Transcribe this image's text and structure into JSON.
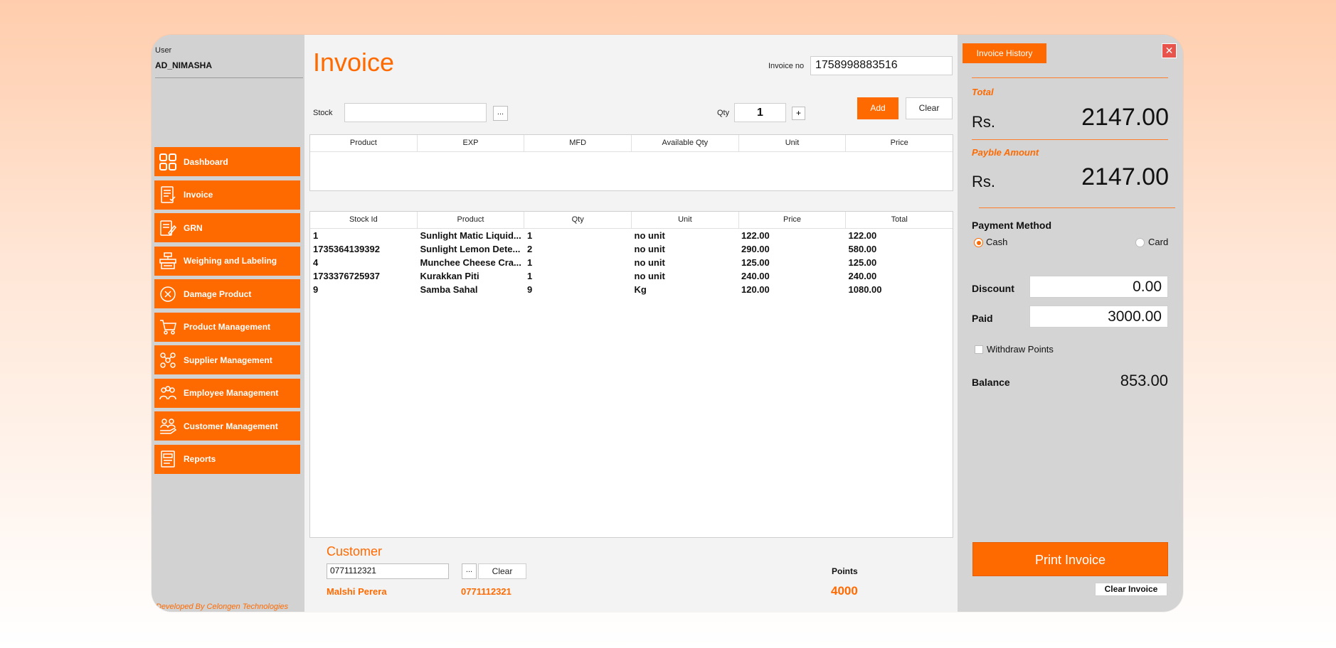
{
  "sidebar": {
    "user_label": "User",
    "user_name": "AD_NIMASHA",
    "items": [
      {
        "label": "Dashboard",
        "icon": "dashboard-icon"
      },
      {
        "label": "Invoice",
        "icon": "invoice-icon"
      },
      {
        "label": "GRN",
        "icon": "grn-icon"
      },
      {
        "label": "Weighing and Labeling",
        "icon": "scale-icon"
      },
      {
        "label": "Damage Product",
        "icon": "damage-icon"
      },
      {
        "label": "Product Management",
        "icon": "cart-icon"
      },
      {
        "label": "Supplier Management",
        "icon": "supplier-icon"
      },
      {
        "label": "Employee Management",
        "icon": "employee-icon"
      },
      {
        "label": "Customer Management",
        "icon": "customer-icon"
      },
      {
        "label": "Reports",
        "icon": "report-icon"
      }
    ],
    "credit": "Developed By Celongen Technologies"
  },
  "main": {
    "title": "Invoice",
    "invoice_no_label": "Invoice no",
    "invoice_no": "1758998883516",
    "stock_label": "Stock",
    "stock_value": "",
    "dots_label": "...",
    "qty_label": "Qty",
    "qty_value": "1",
    "plus_label": "+",
    "add_label": "Add",
    "clear_label": "Clear",
    "stock_table": {
      "columns": [
        "Product",
        "EXP",
        "MFD",
        "Available Qty",
        "Unit",
        "Price"
      ],
      "rows": []
    },
    "invoice_table": {
      "columns": [
        "Stock Id",
        "Product",
        "Qty",
        "Unit",
        "Price",
        "Total"
      ],
      "rows": [
        [
          "1",
          "Sunlight Matic Liquid...",
          "1",
          "no unit",
          "122.00",
          "122.00"
        ],
        [
          "1735364139392",
          "Sunlight Lemon Dete...",
          "2",
          "no unit",
          "290.00",
          "580.00"
        ],
        [
          "4",
          "Munchee Cheese Cra...",
          "1",
          "no unit",
          "125.00",
          "125.00"
        ],
        [
          "1733376725937",
          "Kurakkan Piti",
          "1",
          "no unit",
          "240.00",
          "240.00"
        ],
        [
          "9",
          "Samba Sahal",
          "9",
          "Kg",
          "120.00",
          "1080.00"
        ]
      ]
    },
    "customer": {
      "title": "Customer",
      "phone_input": "0771112321",
      "dots_label": "...",
      "clear_label": "Clear",
      "name": "Malshi Perera",
      "phone": "0771112321",
      "points_label": "Points",
      "points": "4000"
    }
  },
  "right": {
    "history_label": "Invoice History",
    "close_label": "✕",
    "total_label": "Total",
    "currency": "Rs.",
    "total": "2147.00",
    "payable_label": "Payble Amount",
    "payable": "2147.00",
    "payment_method_label": "Payment Method",
    "cash_label": "Cash",
    "card_label": "Card",
    "selected_method": "Cash",
    "discount_label": "Discount",
    "discount": "0.00",
    "paid_label": "Paid",
    "paid": "3000.00",
    "withdraw_label": "Withdraw Points",
    "balance_label": "Balance",
    "balance": "853.00",
    "print_label": "Print Invoice",
    "clear_invoice_label": "Clear Invoice"
  },
  "colors": {
    "accent": "#ff6a00",
    "sidebar_bg": "#d2d2d2",
    "right_bg": "#d4d4d4",
    "main_bg": "#f3f3f3",
    "close_red": "#e8534c"
  }
}
